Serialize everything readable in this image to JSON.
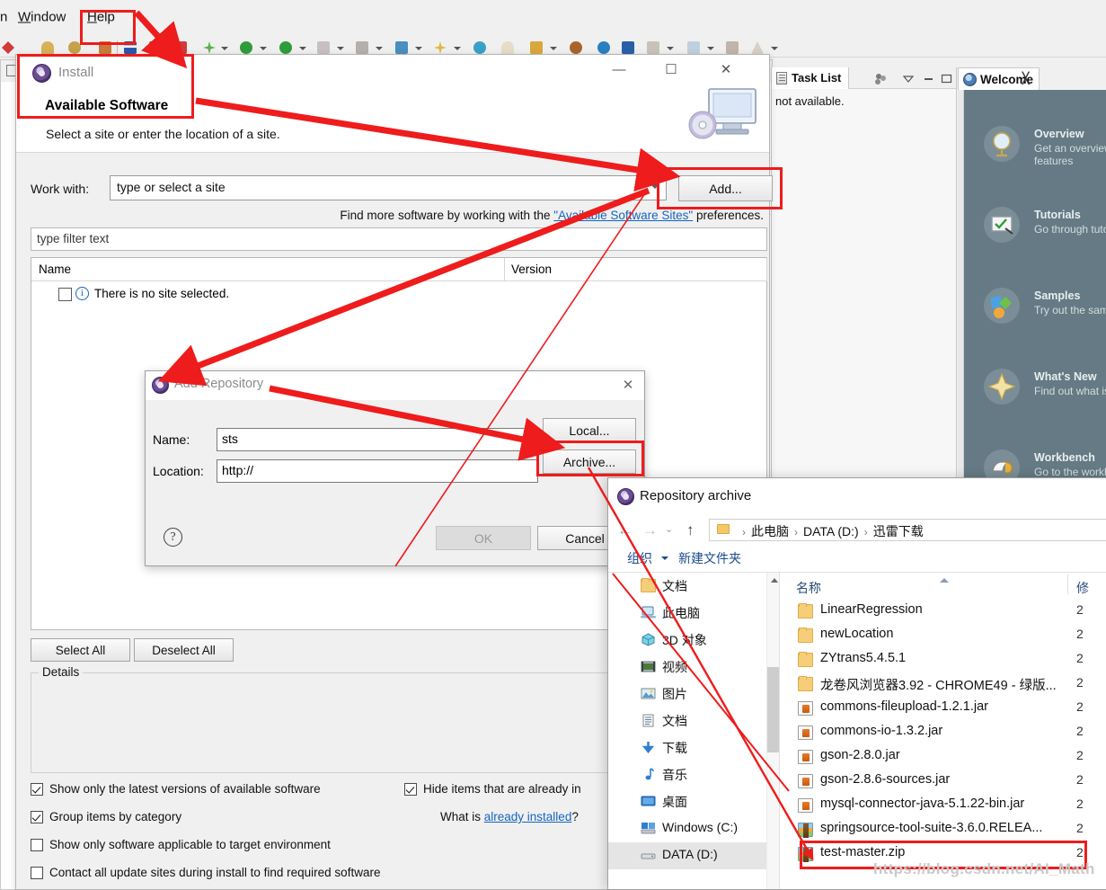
{
  "eclipse": {
    "menubar": {
      "items": [
        "n",
        "Window",
        "Help"
      ]
    },
    "tasklist": {
      "tab_label": "Task List",
      "body_text": "not available.",
      "icon": "task-list-icon"
    },
    "welcome": {
      "tab_label": "Welcome",
      "close_glyph": "╳",
      "items": [
        {
          "title": "Overview",
          "desc": "Get an overview of features",
          "icon": "globe-icon"
        },
        {
          "title": "Tutorials",
          "desc": "Go through tutorials",
          "icon": "tutorial-icon"
        },
        {
          "title": "Samples",
          "desc": "Try out the samples",
          "icon": "samples-icon"
        },
        {
          "title": "What's New",
          "desc": "Find out what is new",
          "icon": "star-icon"
        },
        {
          "title": "Workbench",
          "desc": "Go to the workbench",
          "icon": "workbench-icon"
        }
      ]
    }
  },
  "install_dialog": {
    "title": "Install",
    "heading": "Available Software",
    "subheading": "Select a site or enter the location of a site.",
    "minimize_glyph": "—",
    "maximize_glyph": "☐",
    "close_glyph": "✕",
    "work_with_label": "Work with:",
    "work_with_value": "type or select a site",
    "add_button": "Add...",
    "find_more_prefix": "Find more software by working with the ",
    "find_more_link": "\"Available Software Sites\"",
    "find_more_suffix": " preferences.",
    "filter_placeholder": "type filter text",
    "table": {
      "columns": [
        "Name",
        "Version"
      ],
      "rows": [
        {
          "name": "There is no site selected.",
          "version": "",
          "checked": false
        }
      ]
    },
    "select_all": "Select All",
    "deselect_all": "Deselect All",
    "details_legend": "Details",
    "details_text": "",
    "options": [
      {
        "label": "Show only the latest versions of available software",
        "checked": true
      },
      {
        "label": "Group items by category",
        "checked": true
      },
      {
        "label": "Show only software applicable to target environment",
        "checked": false
      },
      {
        "label": "Contact all update sites during install to find required software",
        "checked": false
      }
    ],
    "options_right": [
      {
        "label": "Hide items that are already in",
        "checked": true
      }
    ],
    "already_installed_prefix": "What is ",
    "already_installed_link": "already installed",
    "already_installed_suffix": "?"
  },
  "add_repository_dialog": {
    "title": "Add Repository",
    "close_glyph": "✕",
    "name_label": "Name:",
    "name_value": "sts",
    "location_label": "Location:",
    "location_value": "http://",
    "local_button": "Local...",
    "archive_button": "Archive...",
    "help_glyph": "?",
    "ok_button": "OK",
    "cancel_button": "Cancel"
  },
  "explorer": {
    "title": "Repository archive",
    "nav": {
      "back": "←",
      "forward": "→",
      "recent": "⌄",
      "up": "↑"
    },
    "breadcrumb": [
      "此电脑",
      "DATA (D:)",
      "迅雷下载"
    ],
    "breadcrumb_separator": "›",
    "toolbar": {
      "organize": "组织",
      "new_folder": "新建文件夹"
    },
    "sidebar": [
      {
        "label": "文档",
        "icon": "folder-icon",
        "selected": false
      },
      {
        "label": "此电脑",
        "icon": "computer-icon",
        "selected": false
      },
      {
        "label": "3D 对象",
        "icon": "cube-icon",
        "selected": false
      },
      {
        "label": "视频",
        "icon": "video-icon",
        "selected": false
      },
      {
        "label": "图片",
        "icon": "picture-icon",
        "selected": false
      },
      {
        "label": "文档",
        "icon": "document-icon",
        "selected": false
      },
      {
        "label": "下载",
        "icon": "download-icon",
        "selected": false
      },
      {
        "label": "音乐",
        "icon": "music-icon",
        "selected": false
      },
      {
        "label": "桌面",
        "icon": "desktop-icon",
        "selected": false
      },
      {
        "label": "Windows (C:)",
        "icon": "drive-icon",
        "selected": false
      },
      {
        "label": "DATA (D:)",
        "icon": "drive-icon",
        "selected": true
      }
    ],
    "columns": {
      "name": "名称",
      "modified": "修"
    },
    "files": [
      {
        "name": "LinearRegression",
        "type": "folder",
        "date": "2"
      },
      {
        "name": "newLocation",
        "type": "folder",
        "date": "2"
      },
      {
        "name": "ZYtrans5.4.5.1",
        "type": "folder",
        "date": "2"
      },
      {
        "name": "龙卷风浏览器3.92 - CHROME49 - 绿版...",
        "type": "folder",
        "date": "2"
      },
      {
        "name": "commons-fileupload-1.2.1.jar",
        "type": "jar",
        "date": "2"
      },
      {
        "name": "commons-io-1.3.2.jar",
        "type": "jar",
        "date": "2"
      },
      {
        "name": "gson-2.8.0.jar",
        "type": "jar",
        "date": "2"
      },
      {
        "name": "gson-2.8.6-sources.jar",
        "type": "jar",
        "date": "2"
      },
      {
        "name": "mysql-connector-java-5.1.22-bin.jar",
        "type": "jar",
        "date": "2"
      },
      {
        "name": "springsource-tool-suite-3.6.0.RELEA...",
        "type": "zip",
        "date": "2"
      },
      {
        "name": "test-master.zip",
        "type": "zip",
        "date": "2"
      }
    ]
  },
  "annotations": {
    "accent_color": "#ee1c1c",
    "watermark": "https://blog.csdn.net/AI_Math",
    "highlight_boxes": [
      "help-menu",
      "install-header",
      "add-button",
      "archive-button",
      "springsource-file"
    ]
  }
}
